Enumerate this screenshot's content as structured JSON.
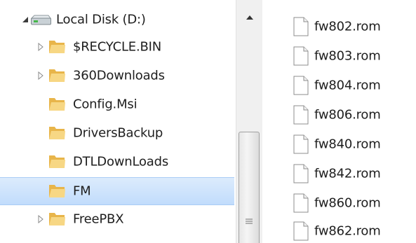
{
  "tree": {
    "root": {
      "label": "Local Disk (D:)",
      "expanded": true,
      "icon": "drive-icon"
    },
    "items": [
      {
        "label": "$RECYCLE.BIN",
        "has_children": true,
        "selected": false
      },
      {
        "label": "360Downloads",
        "has_children": true,
        "selected": false
      },
      {
        "label": "Config.Msi",
        "has_children": false,
        "selected": false
      },
      {
        "label": "DriversBackup",
        "has_children": false,
        "selected": false
      },
      {
        "label": "DTLDownLoads",
        "has_children": false,
        "selected": false
      },
      {
        "label": "FM",
        "has_children": false,
        "selected": true
      },
      {
        "label": "FreePBX",
        "has_children": true,
        "selected": false
      }
    ]
  },
  "files": [
    {
      "name": "fw802.rom"
    },
    {
      "name": "fw803.rom"
    },
    {
      "name": "fw804.rom"
    },
    {
      "name": "fw806.rom"
    },
    {
      "name": "fw840.rom"
    },
    {
      "name": "fw842.rom"
    },
    {
      "name": "fw860.rom"
    },
    {
      "name": "fw862.rom"
    }
  ],
  "colors": {
    "selection": "#cce4fb",
    "folder": "#e8b54a",
    "text": "#1e1e1e"
  }
}
